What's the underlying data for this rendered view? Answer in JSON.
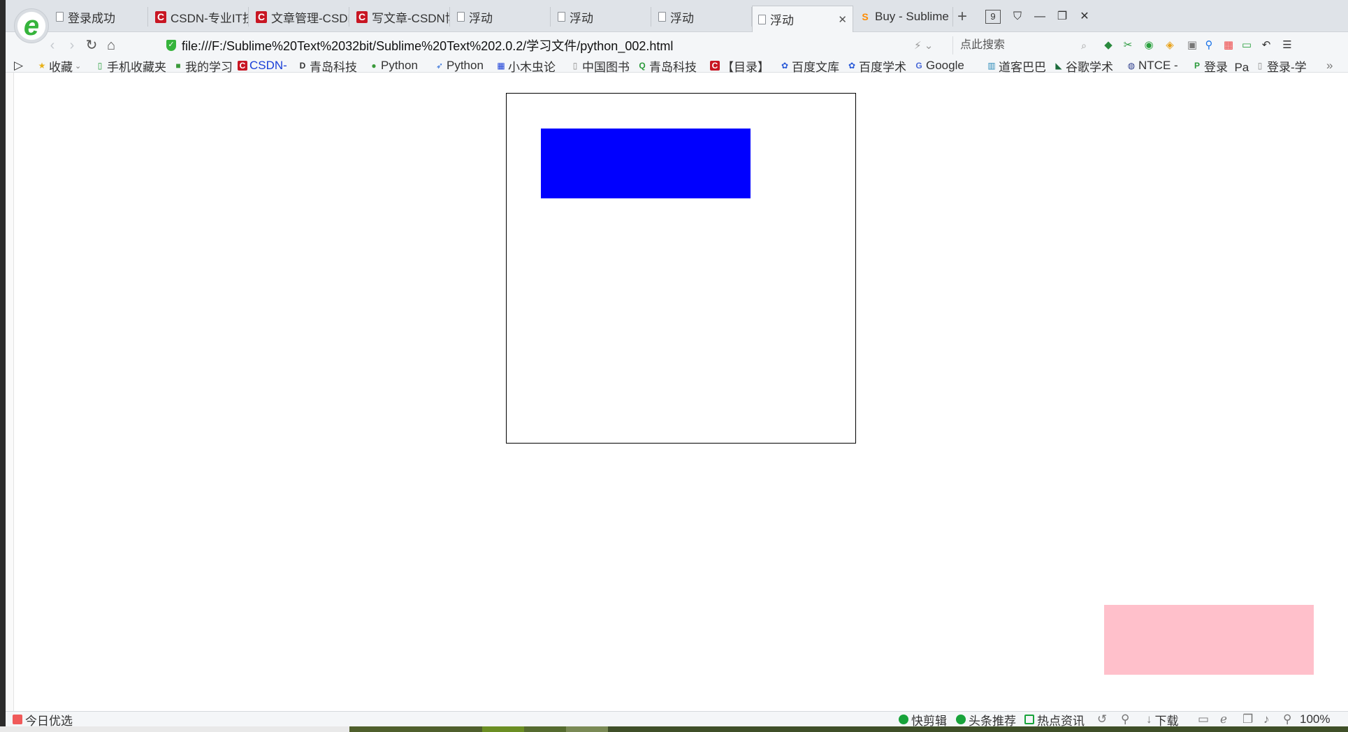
{
  "tabs": [
    {
      "title": "登录成功",
      "icon": "doc"
    },
    {
      "title": "CSDN-专业IT技",
      "icon": "csdn"
    },
    {
      "title": "文章管理-CSDN",
      "icon": "csdn"
    },
    {
      "title": "写文章-CSDN博",
      "icon": "csdn"
    },
    {
      "title": "浮动",
      "icon": "doc"
    },
    {
      "title": "浮动",
      "icon": "doc"
    },
    {
      "title": "浮动",
      "icon": "doc"
    },
    {
      "title": "浮动",
      "icon": "doc",
      "active": true
    },
    {
      "title": "Buy - Sublime",
      "icon": "sublime"
    }
  ],
  "tab_count": "9",
  "address": {
    "url": "file:///F:/Sublime%20Text%2032bit/Sublime%20Text%202.0.2/学习文件/python_002.html",
    "search_placeholder": "点此搜索"
  },
  "bookmarks": [
    {
      "label": "收藏",
      "icon": "star-icon"
    },
    {
      "label": "手机收藏夹",
      "icon": "phone-icon"
    },
    {
      "label": "我的学习",
      "icon": "book-icon"
    },
    {
      "label": "CSDN-",
      "icon": "csdn-icon"
    },
    {
      "label": "青岛科技",
      "icon": "d-icon"
    },
    {
      "label": "Python",
      "icon": "python-icon"
    },
    {
      "label": "Python",
      "icon": "rocket-icon"
    },
    {
      "label": "小木虫论",
      "icon": "grid-icon"
    },
    {
      "label": "中国图书",
      "icon": "doc-icon"
    },
    {
      "label": "青岛科技",
      "icon": "q-icon"
    },
    {
      "label": "【目录】",
      "icon": "csdn-icon"
    },
    {
      "label": "百度文库",
      "icon": "baidu-icon"
    },
    {
      "label": "百度学术",
      "icon": "baidu-icon"
    },
    {
      "label": "Google",
      "icon": "google-icon"
    },
    {
      "label": "道客巴巴",
      "icon": "doc88-icon"
    },
    {
      "label": "谷歌学术",
      "icon": "scholar-icon"
    },
    {
      "label": "NTCE -",
      "icon": "ntce-icon"
    },
    {
      "label": "登录_Pa",
      "icon": "pp-icon"
    },
    {
      "label": "登录-学",
      "icon": "doc-icon"
    }
  ],
  "statusbar": {
    "today": "今日优选",
    "quick_clip": "快剪辑",
    "headline": "头条推荐",
    "hot_news": "热点资讯",
    "download": "下载",
    "zoom": "100%"
  },
  "colors": {
    "container_border": "#000000",
    "blue_box": "#0000ff",
    "pink_box": "#ffc0cb"
  }
}
